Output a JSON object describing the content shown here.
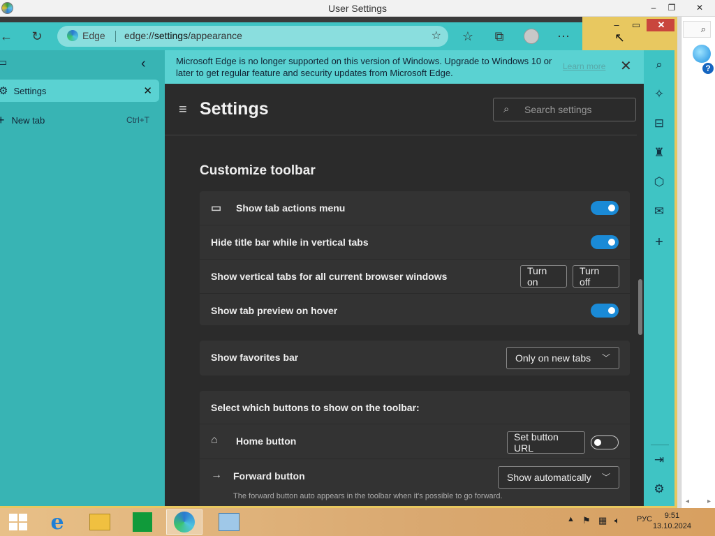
{
  "window": {
    "title": "User Settings",
    "minimize": "–",
    "restore": "❐",
    "close": "✕"
  },
  "outer": {
    "search_glyph": "⌕",
    "help": "?",
    "scroll_left": "◂",
    "scroll_right": "▸"
  },
  "toolbar": {
    "brand": "Edge",
    "url_prefix": "edge://",
    "url_path": "settings",
    "url_suffix": "/appearance",
    "back": "←",
    "refresh": "↻",
    "fav_add": "☆",
    "favorites": "☆",
    "collections": "⧉",
    "more": "⋯",
    "win_min": "–",
    "win_max": "▭",
    "win_close": "✕"
  },
  "vtabs": {
    "panel_icon": "▭",
    "collapse": "‹",
    "active_tab": "Settings",
    "active_close": "✕",
    "new_tab": "New tab",
    "new_tab_shortcut": "Ctrl+T",
    "new_tab_plus": "+"
  },
  "banner": {
    "message": "Microsoft Edge is no longer supported on this version of Windows. Upgrade to Windows 10 or later to get regular feature and security updates from Microsoft Edge.",
    "learn_more": "Learn more",
    "close": "✕"
  },
  "settings": {
    "title": "Settings",
    "menu": "≡",
    "search_placeholder": "Search settings",
    "section": "Customize toolbar",
    "rows": [
      {
        "label": "Show tab actions menu",
        "control": "toggle",
        "on": true
      },
      {
        "label": "Hide title bar while in vertical tabs",
        "control": "toggle",
        "on": true
      },
      {
        "label": "Show vertical tabs for all current browser windows",
        "btn_on": "Turn on",
        "btn_off": "Turn off"
      },
      {
        "label": "Show tab preview on hover",
        "control": "toggle",
        "on": true
      }
    ],
    "favorites_bar": {
      "label": "Show favorites bar",
      "value": "Only on new tabs"
    },
    "buttons_header": "Select which buttons to show on the toolbar:",
    "home": {
      "label": "Home button",
      "set_url": "Set button URL",
      "on": false
    },
    "forward": {
      "label": "Forward button",
      "value": "Show automatically",
      "hint": "The forward button auto appears in the toolbar when it's possible to go forward."
    }
  },
  "taskbar": {
    "lang": "РУС",
    "time": "9:51",
    "date": "13.10.2024",
    "tray_up": "▲"
  },
  "colors": {
    "teal": "#3fc4c4",
    "banner": "#5ad2d2",
    "toggle_on": "#1a8ad6",
    "content_bg": "#2b2b2b"
  }
}
